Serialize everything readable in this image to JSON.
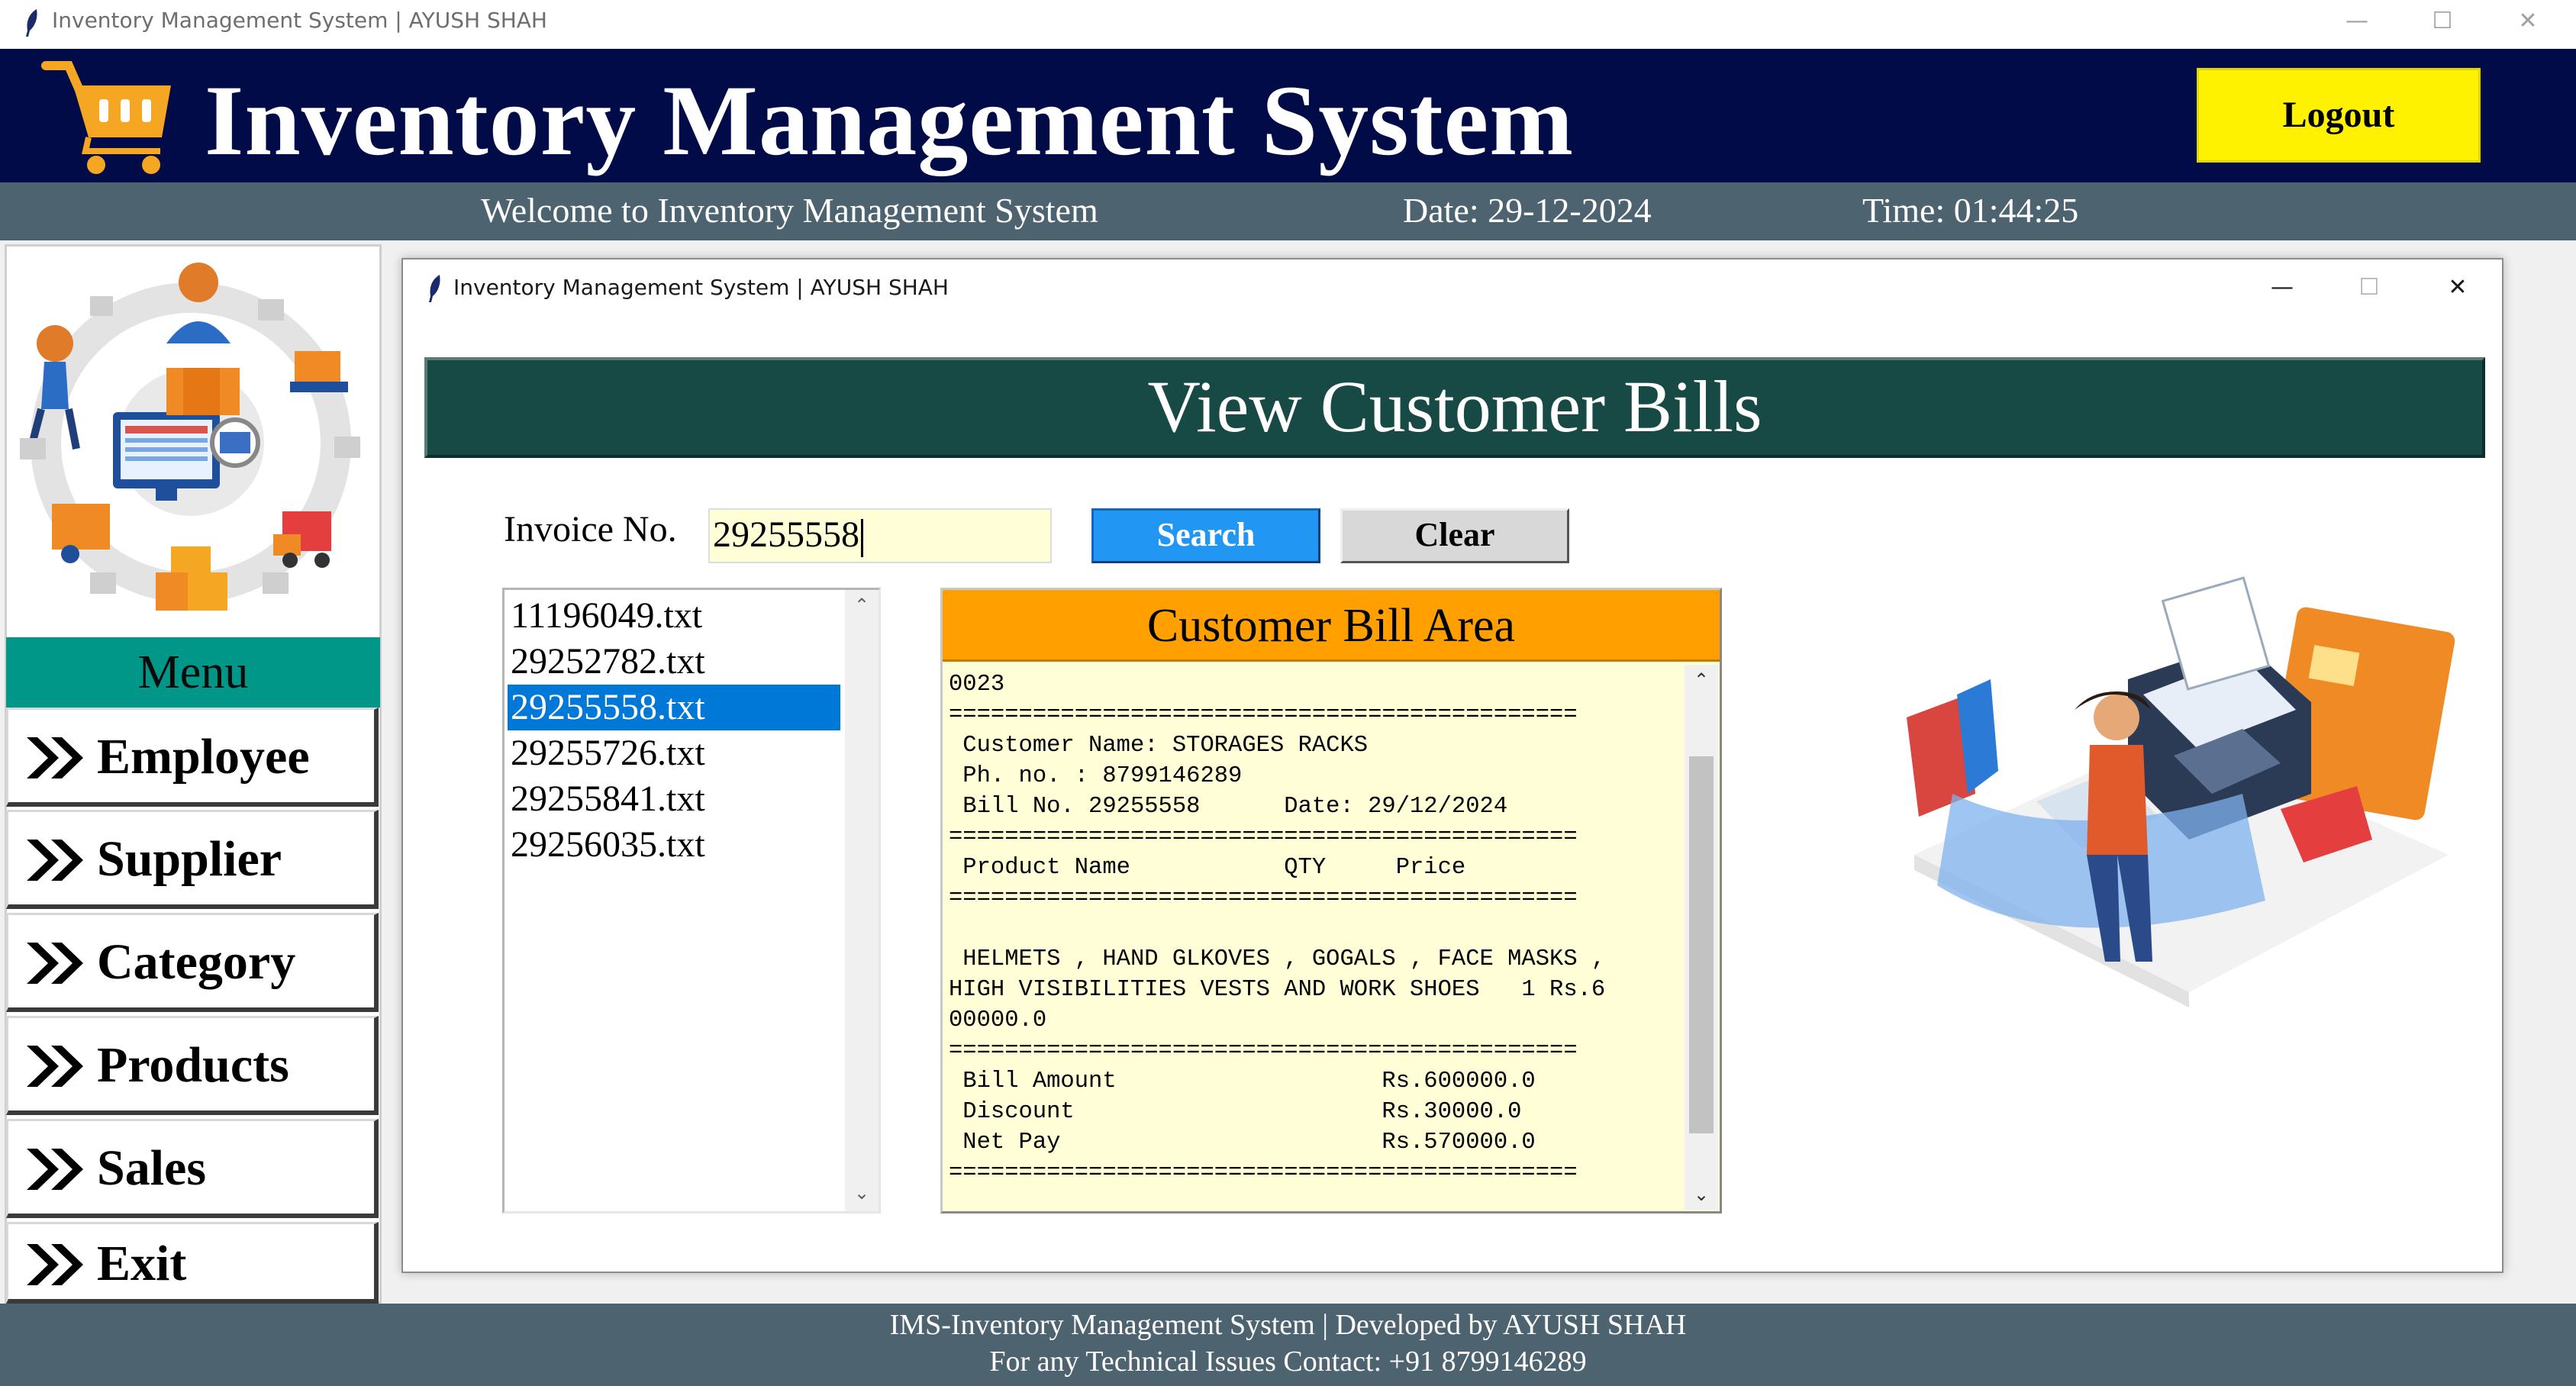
{
  "window": {
    "title": "Inventory Management System | AYUSH SHAH",
    "minimize": "—",
    "maximize": "☐",
    "close": "✕"
  },
  "header": {
    "title": "Inventory Management System",
    "logout_label": "Logout",
    "bg_color": "#010b47",
    "logout_color": "#fff200"
  },
  "status_bar": {
    "welcome": "Welcome to Inventory Management System",
    "date": "Date: 29-12-2024",
    "time": "Time: 01:44:25"
  },
  "sidebar": {
    "menu_title": "Menu",
    "items": [
      {
        "label": "Employee",
        "icon": "double-chevron-right-icon"
      },
      {
        "label": "Supplier",
        "icon": "double-chevron-right-icon"
      },
      {
        "label": "Category",
        "icon": "double-chevron-right-icon"
      },
      {
        "label": "Products",
        "icon": "double-chevron-right-icon"
      },
      {
        "label": "Sales",
        "icon": "double-chevron-right-icon"
      },
      {
        "label": "Exit",
        "icon": "double-chevron-right-icon"
      }
    ],
    "menu_color": "#009688"
  },
  "child_window": {
    "title": "Inventory Management System | AYUSH SHAH",
    "minimize": "—",
    "maximize": "☐",
    "close": "✕",
    "banner": "View Customer Bills",
    "banner_color": "#184a45",
    "invoice_label": "Invoice No.",
    "invoice_value": "29255558",
    "search_label": "Search",
    "clear_label": "Clear",
    "files": [
      "11196049.txt",
      "29252782.txt",
      "29255558.txt",
      "29255726.txt",
      "29255841.txt",
      "29256035.txt"
    ],
    "selected_file": "29255558.txt",
    "bill_area_title": "Customer Bill Area",
    "bill_lines": [
      "0023",
      "=============================================",
      " Customer Name: STORAGES RACKS",
      " Ph. no. : 8799146289",
      " Bill No. 29255558      Date: 29/12/2024",
      "=============================================",
      " Product Name           QTY     Price",
      "=============================================",
      "",
      " HELMETS , HAND GLKOVES , GOGALS , FACE MASKS ,",
      "HIGH VISIBILITIES VESTS AND WORK SHOES   1 Rs.6",
      "00000.0",
      "=============================================",
      " Bill Amount                   Rs.600000.0",
      " Discount                      Rs.30000.0",
      " Net Pay                       Rs.570000.0",
      "============================================="
    ]
  },
  "footer": {
    "line1": "IMS-Inventory Management System | Developed by AYUSH SHAH",
    "line2": "For any Technical Issues Contact: +91 8799146289"
  }
}
